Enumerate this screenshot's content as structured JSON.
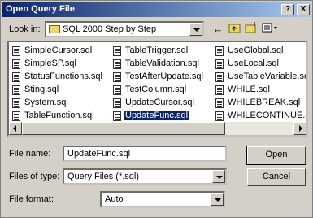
{
  "window": {
    "title": "Open Query File",
    "help_label": "?",
    "close_label": "X"
  },
  "lookin": {
    "label": "Look in:",
    "value": "SQL 2000 Step by Step"
  },
  "toolbar": {
    "back_icon": "←",
    "up_icon": "folder-up-icon",
    "newfolder_icon": "new-folder-icon",
    "views_icon": "views-menu-icon"
  },
  "files": [
    [
      "SimpleCursor.sql",
      "SimpleSP.sql",
      "StatusFunctions.sql",
      "Sting.sql",
      "System.sql",
      "TableFunction.sql"
    ],
    [
      "TableTrigger.sql",
      "TableValidation.sql",
      "TestAfterUpdate.sql",
      "TestColumn.sql",
      "UpdateCursor.sql",
      "UpdateFunc.sql"
    ],
    [
      "UseGlobal.sql",
      "UseLocal.sql",
      "UseTableVariable.sql",
      "WHILE.sql",
      "WHILEBREAK.sql",
      "WHILECONTINUE.sql"
    ]
  ],
  "selected_file": "UpdateFunc.sql",
  "form": {
    "filename_label": "File name:",
    "filename_value": "UpdateFunc.sql",
    "filetype_label": "Files of type:",
    "filetype_value": "Query Files (*.sql)",
    "format_label": "File format:",
    "format_value": "Auto"
  },
  "buttons": {
    "open": "Open",
    "cancel": "Cancel"
  }
}
